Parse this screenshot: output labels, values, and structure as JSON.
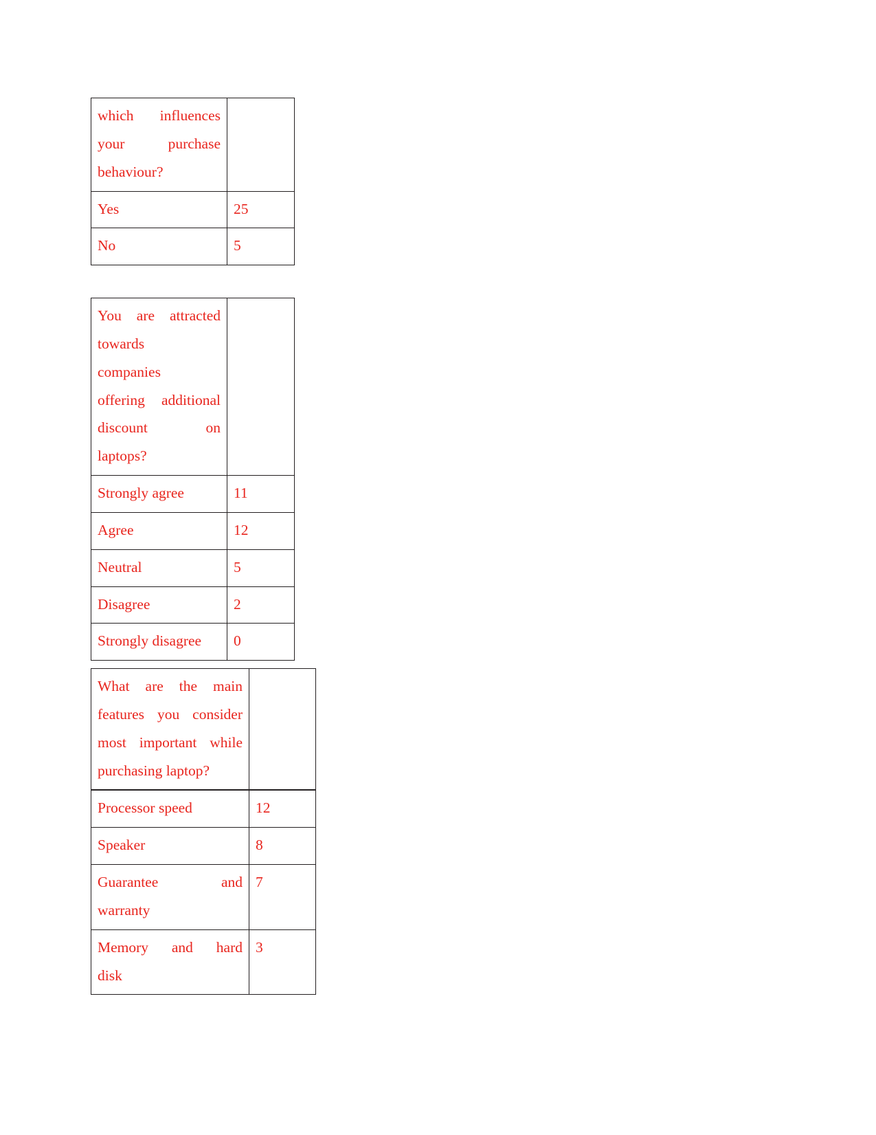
{
  "document": {
    "page_background": "#FFFFFF",
    "text_color": "#E8251E",
    "border_color": "#231F20"
  },
  "tables": [
    {
      "id": "table-1",
      "question_lines": [
        "which influences",
        "your purchase",
        "behaviour?"
      ],
      "question_full": "which influences your purchase behaviour?",
      "rows": [
        {
          "label": "Yes",
          "value": "25"
        },
        {
          "label": "No",
          "value": "5"
        }
      ]
    },
    {
      "id": "table-2",
      "question_lines": [
        "You are attracted",
        "towards",
        "companies",
        "offering additional",
        "discount on",
        "laptops?"
      ],
      "question_full": "You are attracted towards companies offering additional discount on laptops?",
      "rows": [
        {
          "label": "Strongly agree",
          "value": "11"
        },
        {
          "label": "Agree",
          "value": "12"
        },
        {
          "label": "Neutral",
          "value": "5"
        },
        {
          "label": "Disagree",
          "value": "2"
        },
        {
          "label": "Strongly disagree",
          "value": "0"
        }
      ]
    },
    {
      "id": "table-3",
      "question_lines": [
        "What are the main",
        "features you consider",
        "most important while",
        "purchasing laptop?"
      ],
      "question_full": "What are the main features you consider most important while purchasing laptop?",
      "rows": [
        {
          "label": "Processor speed",
          "value": "12"
        },
        {
          "label": "Speaker",
          "value": "8"
        },
        {
          "label_lines": [
            "Guarantee and",
            "warranty"
          ],
          "label": "Guarantee and warranty",
          "value": "7"
        },
        {
          "label_lines": [
            "Memory and hard",
            "disk"
          ],
          "label": "Memory and hard disk",
          "value": "3"
        }
      ]
    }
  ]
}
